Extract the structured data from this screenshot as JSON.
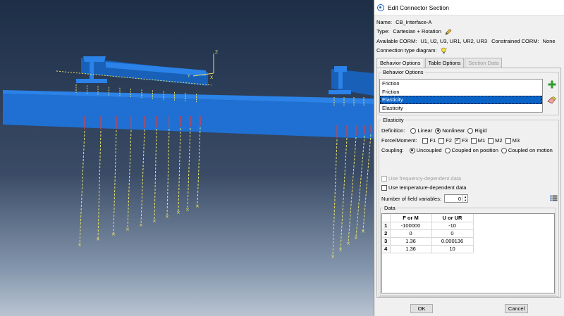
{
  "viewport": {
    "axis_labels": {
      "z_top": "Z",
      "y_left": "Y",
      "x_mid": "X"
    },
    "colors": {
      "beam": "#1f70d2",
      "beam_top": "#2b82e8",
      "beam_side": "#1860b8",
      "connector": "#e8e06a",
      "load_arrow": "#d94040"
    }
  },
  "dialog": {
    "title": "Edit Connector Section",
    "name_label": "Name:",
    "name_value": "CB_Interface-A",
    "type_label": "Type:",
    "type_value": "Cartesian + Rotation",
    "available_label": "Available CORM:",
    "available_value": "U1, U2, U3, UR1, UR2, UR3",
    "constrained_label": "Constrained CORM:",
    "constrained_value": "None",
    "diagram_label": "Connection type diagram:",
    "tabs": [
      {
        "label": "Behavior Options",
        "state": "active"
      },
      {
        "label": "Table Options",
        "state": "normal"
      },
      {
        "label": "Section Data",
        "state": "disabled"
      }
    ],
    "behavior_options": {
      "legend": "Behavior Options",
      "items": [
        {
          "label": "Friction",
          "selected": false
        },
        {
          "label": "Friction",
          "selected": false
        },
        {
          "label": "Elasticity",
          "selected": true
        },
        {
          "label": "Elasticity",
          "selected": false
        }
      ]
    },
    "elasticity": {
      "legend": "Elasticity",
      "definition_label": "Definition:",
      "definition_options": [
        "Linear",
        "Nonlinear",
        "Rigid"
      ],
      "definition_selected": "Nonlinear",
      "force_label": "Force/Moment:",
      "force_options": [
        {
          "label": "F1",
          "checked": false
        },
        {
          "label": "F2",
          "checked": false
        },
        {
          "label": "F3",
          "checked": true
        },
        {
          "label": "M1",
          "checked": false
        },
        {
          "label": "M2",
          "checked": false
        },
        {
          "label": "M3",
          "checked": false
        }
      ],
      "coupling_label": "Coupling:",
      "coupling_options": [
        "Uncoupled",
        "Coupled on position",
        "Coupled on motion"
      ],
      "coupling_selected": "Uncoupled",
      "use_frequency": "Use frequency-dependent data",
      "use_temperature": "Use temperature-dependent data",
      "field_vars_label": "Number of field variables:",
      "field_vars_value": "0"
    },
    "data": {
      "legend": "Data",
      "columns": [
        "F or M",
        "U or UR"
      ],
      "rows": [
        {
          "num": "1",
          "a": "-100000",
          "b": "-10"
        },
        {
          "num": "2",
          "a": "0",
          "b": "0"
        },
        {
          "num": "3",
          "a": "1.36",
          "b": "0.000136"
        },
        {
          "num": "4",
          "a": "1.36",
          "b": "10"
        }
      ]
    },
    "ok_label": "OK",
    "cancel_label": "Cancel"
  }
}
